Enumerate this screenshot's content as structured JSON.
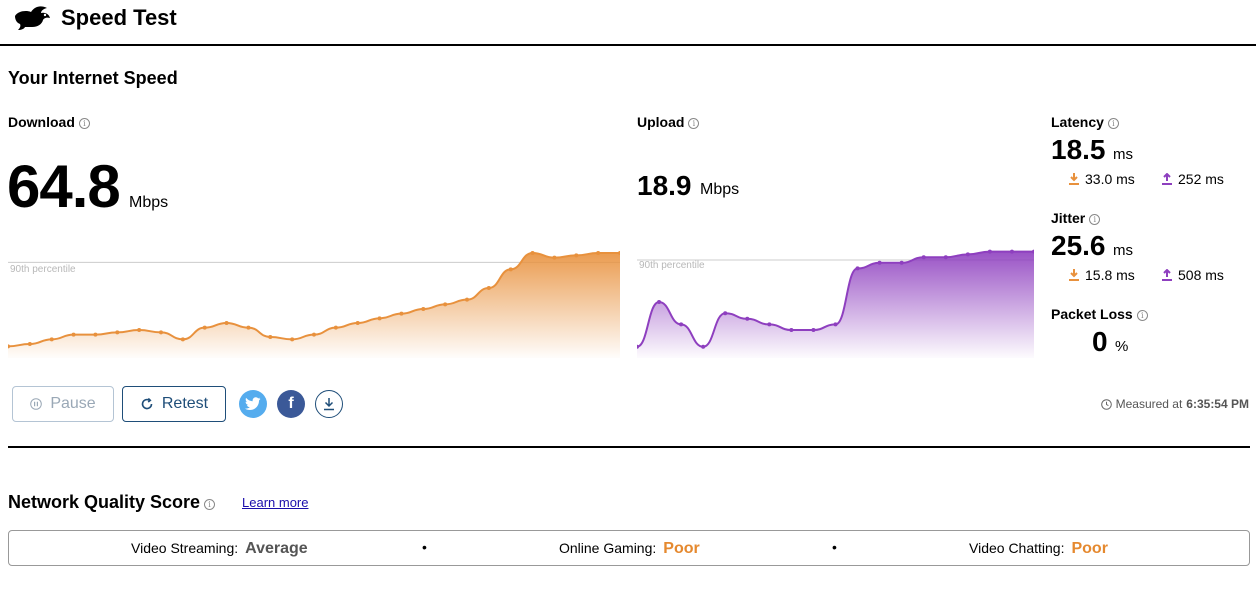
{
  "app": {
    "title": "Speed Test"
  },
  "section_title": "Your Internet Speed",
  "download": {
    "label": "Download",
    "value": "64.8",
    "unit": "Mbps",
    "percentile_label": "90th percentile",
    "chart_color": "#e8913d",
    "series": [
      5,
      6,
      8,
      10,
      10,
      11,
      12,
      11,
      8,
      13,
      15,
      13,
      9,
      8,
      10,
      13,
      15,
      17,
      19,
      21,
      23,
      25,
      30,
      38,
      45,
      43,
      44,
      45,
      45
    ]
  },
  "upload": {
    "label": "Upload",
    "value": "18.9",
    "unit": "Mbps",
    "percentile_label": "90th percentile",
    "chart_color": "#8e3fbf",
    "series": [
      2,
      10,
      6,
      2,
      8,
      7,
      6,
      5,
      5,
      6,
      16,
      17,
      17,
      18,
      18,
      18.5,
      19,
      19,
      19
    ]
  },
  "latency": {
    "label": "Latency",
    "value": "18.5",
    "unit": "ms",
    "down": "33.0 ms",
    "up": "252 ms"
  },
  "jitter": {
    "label": "Jitter",
    "value": "25.6",
    "unit": "ms",
    "down": "15.8 ms",
    "up": "508 ms"
  },
  "packet_loss": {
    "label": "Packet Loss",
    "value": "0",
    "unit": "%"
  },
  "buttons": {
    "pause": "Pause",
    "retest": "Retest"
  },
  "measured": {
    "prefix": "Measured at",
    "time": "6:35:54 PM"
  },
  "network_quality": {
    "title": "Network Quality Score",
    "learn_more": "Learn more",
    "items": [
      {
        "label": "Video Streaming:",
        "value": "Average"
      },
      {
        "label": "Online Gaming:",
        "value": "Poor"
      },
      {
        "label": "Video Chatting:",
        "value": "Poor"
      }
    ],
    "separator": "•"
  },
  "colors": {
    "download_accent": "#e8913d",
    "upload_accent": "#8e3fbf",
    "poor": "#e5892f",
    "average": "#555555",
    "button_border": "#1f4e79"
  }
}
